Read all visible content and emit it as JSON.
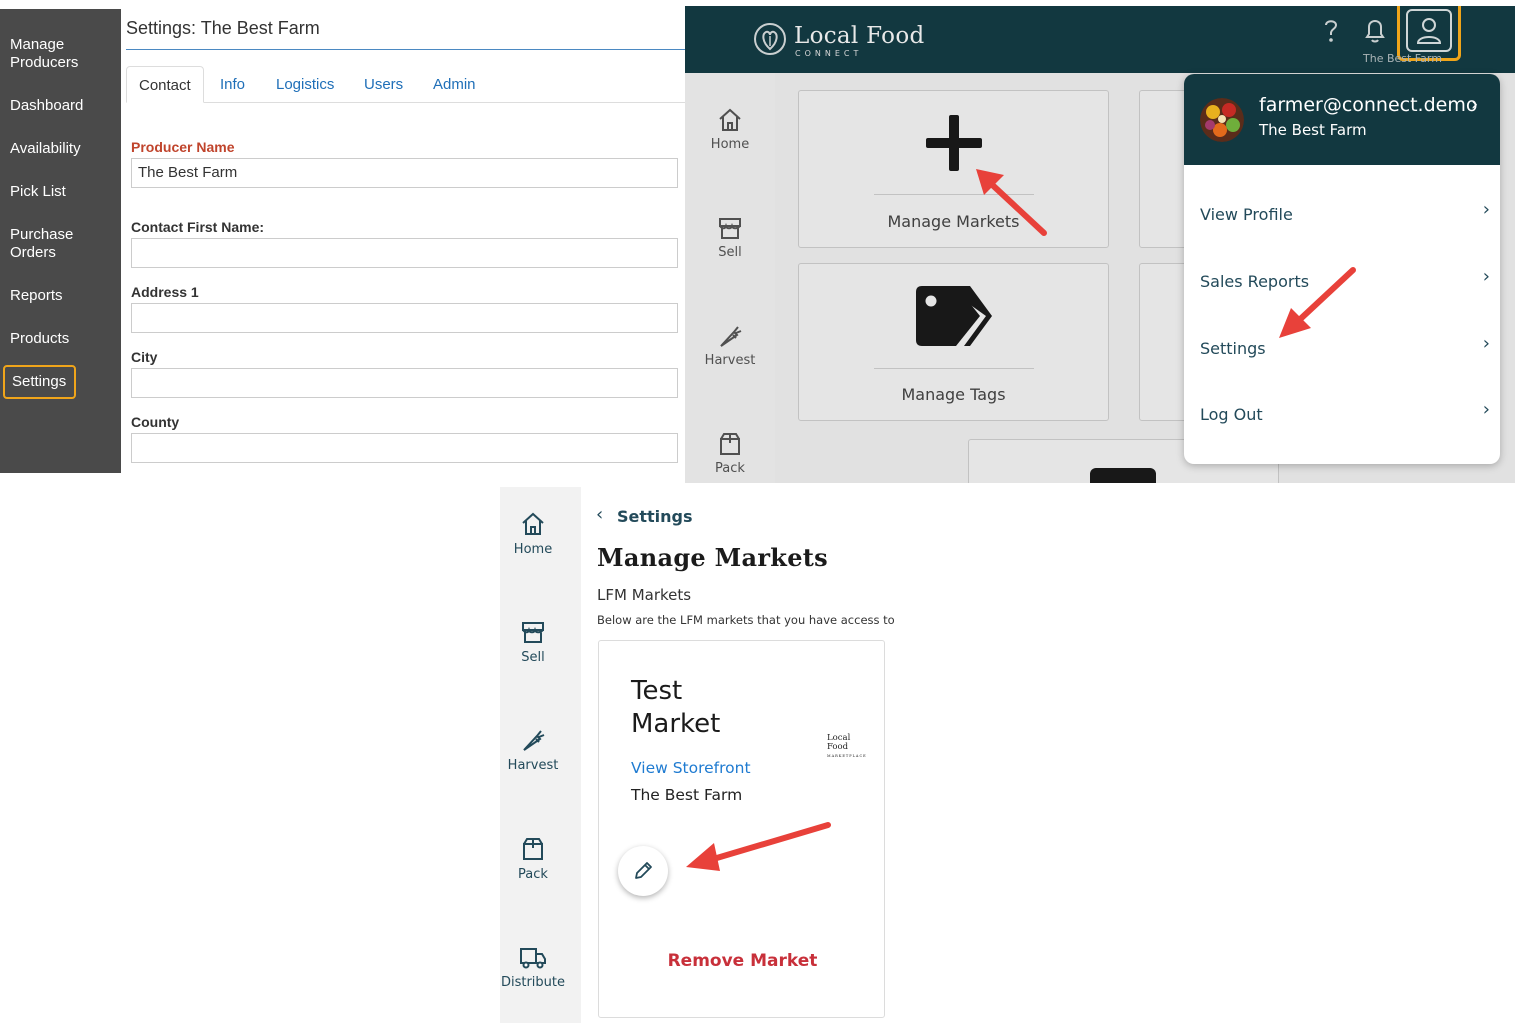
{
  "legacy": {
    "title": "Settings: The Best Farm",
    "nav": [
      "Manage Producers",
      "Dashboard",
      "Availability",
      "Pick List",
      "Purchase Orders",
      "Reports",
      "Products",
      "Settings"
    ],
    "tabs": [
      "Contact",
      "Info",
      "Logistics",
      "Users",
      "Admin"
    ],
    "fields": {
      "producer_name_label": "Producer Name",
      "producer_name_value": "The Best Farm",
      "contact_first_name_label": "Contact First Name:",
      "address1_label": "Address 1",
      "city_label": "City",
      "county_label": "County"
    },
    "colors": {
      "sidebar": "#4a4a4a",
      "active_outline": "#f0a51a",
      "link": "#1f6fb8",
      "required": "#c0442c"
    }
  },
  "app": {
    "brand": "Local Food",
    "brand_sub": "CONNECT",
    "header_user": "The Best Farm",
    "sidebar": [
      "Home",
      "Sell",
      "Harvest",
      "Pack"
    ],
    "cards": [
      "Manage Markets",
      "Manage Tags"
    ],
    "menu": {
      "email": "farmer@connect.demo",
      "farm": "The Best Farm",
      "items": [
        "View Profile",
        "Sales Reports",
        "Settings",
        "Log Out"
      ]
    },
    "colors": {
      "header": "#123840",
      "highlight": "#f0a51a",
      "arrow": "#e8413a"
    }
  },
  "markets": {
    "back_label": "Settings",
    "title": "Manage Markets",
    "subtitle": "LFM Markets",
    "description": "Below are the LFM markets that you have access to",
    "sidebar": [
      "Home",
      "Sell",
      "Harvest",
      "Pack",
      "Distribute"
    ],
    "card": {
      "name": "Test Market",
      "logo_text": "Local Food",
      "logo_sub": "MARKETPLACE",
      "storefront_link": "View Storefront",
      "farm": "The Best Farm",
      "remove_label": "Remove Market"
    },
    "colors": {
      "link": "#1f7bd1",
      "remove": "#c8303a",
      "nav": "#234a5a"
    }
  }
}
